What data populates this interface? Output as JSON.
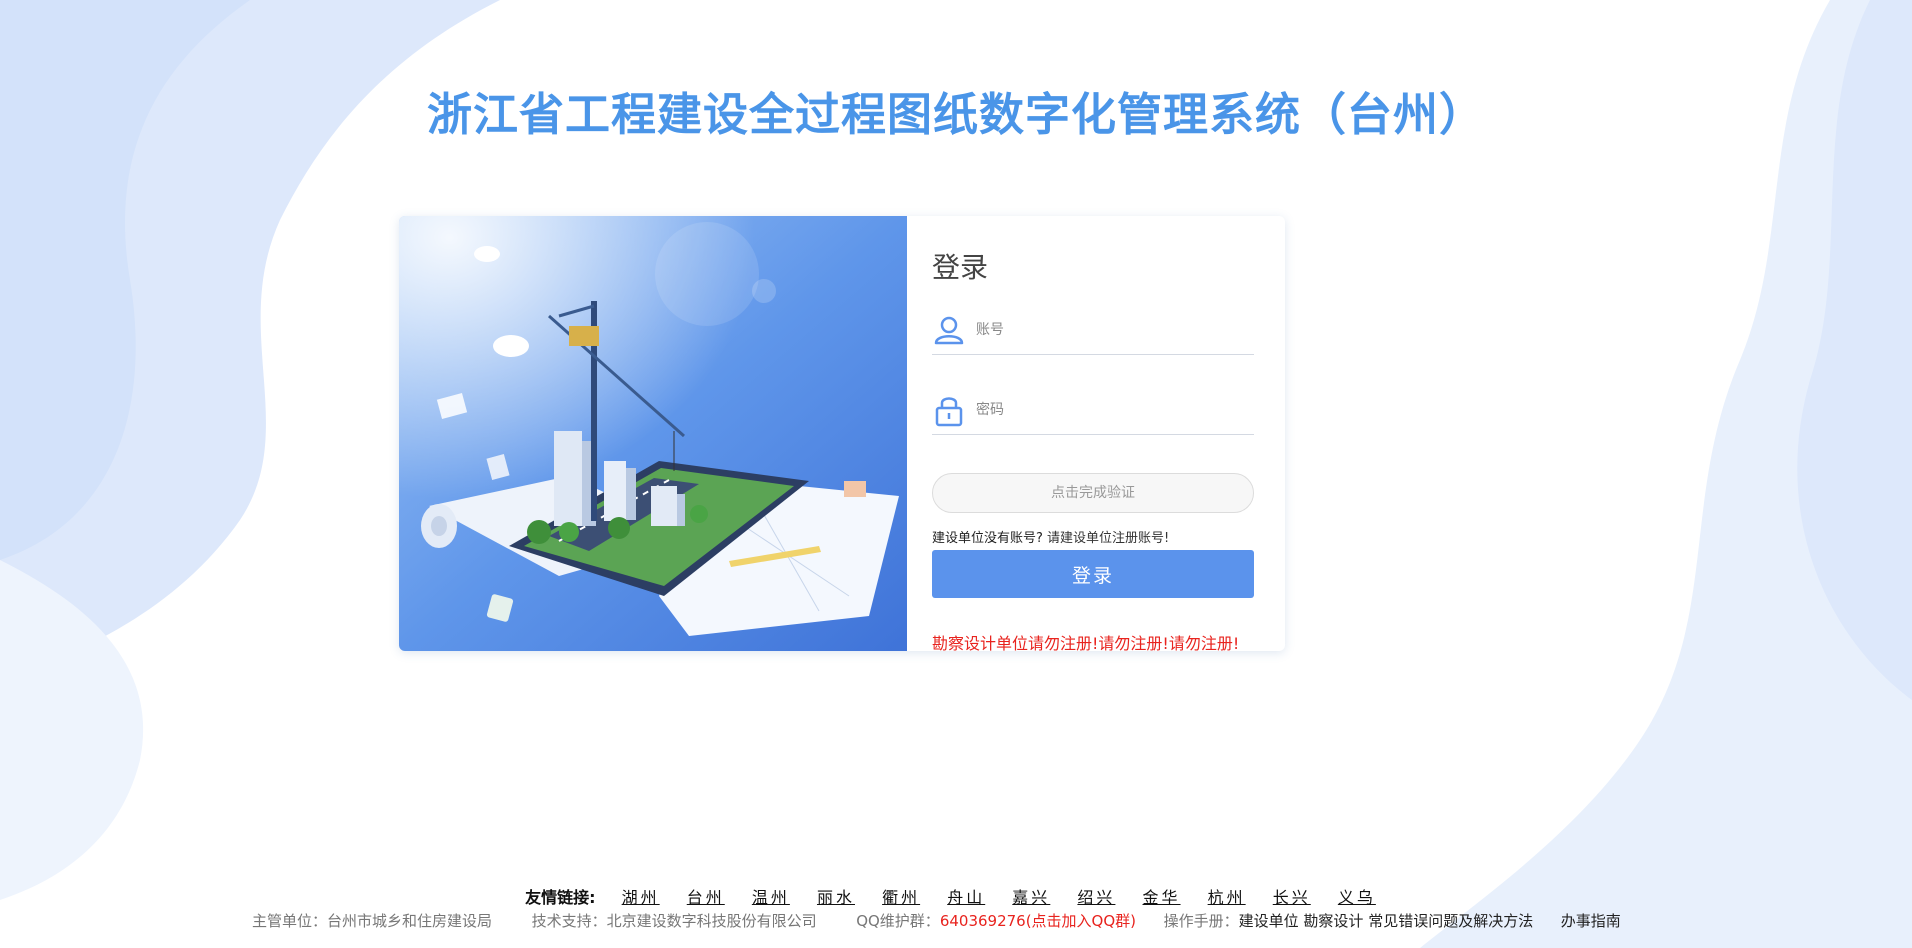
{
  "header": {
    "title": "浙江省工程建设全过程图纸数字化管理系统（台州）"
  },
  "login": {
    "title": "登录",
    "account_placeholder": "账号",
    "password_placeholder": "密码",
    "verify_label": "点击完成验证",
    "no_account_text": "建设单位没有账号?",
    "register_link": "请建设单位注册账号!",
    "login_button": "登录",
    "warning": "勘察设计单位请勿注册!请勿注册!请勿注册!"
  },
  "friend_links": {
    "label": "友情链接:",
    "items": [
      "湖州",
      "台州",
      "温州",
      "丽水",
      "衢州",
      "舟山",
      "嘉兴",
      "绍兴",
      "金华",
      "杭州",
      "长兴",
      "义乌"
    ]
  },
  "footer": {
    "sponsor_label": "主管单位：",
    "sponsor": "台州市城乡和住房建设局",
    "support_label": "技术支持：",
    "support": "北京建设数字科技股份有限公司",
    "qq_label": "QQ维护群：",
    "qq": "640369276(点击加入QQ群)",
    "manual_label": "操作手册：",
    "manuals": [
      "建设单位",
      "勘察设计",
      "常见错误问题及解决方法"
    ],
    "guide": "办事指南"
  },
  "colors": {
    "accent": "#5b93ec",
    "title": "#4a95e8",
    "warning": "#e8231e",
    "bg_wave": "#e6effc"
  },
  "icons": [
    "user-icon",
    "lock-icon"
  ]
}
